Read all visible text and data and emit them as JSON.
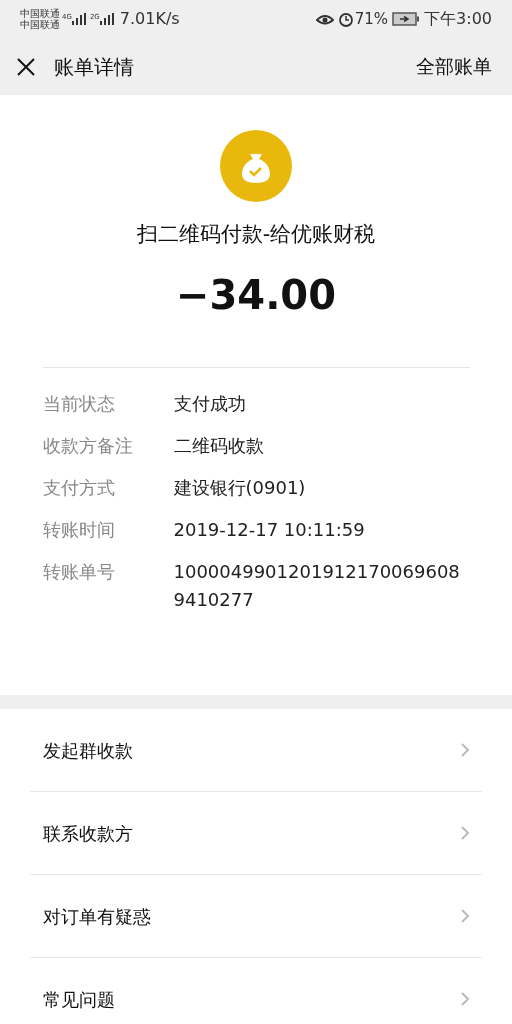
{
  "status_bar": {
    "carriers": [
      "中国联通",
      "中国联通"
    ],
    "networks": [
      "4G",
      "2G"
    ],
    "speed": "7.01K/s",
    "battery": "71%",
    "time": "下午3:00"
  },
  "header": {
    "title": "账单详情",
    "action": "全部账单"
  },
  "summary": {
    "title": "扫二维码付款-给优账财税",
    "amount": "−34.00"
  },
  "details": [
    {
      "label": "当前状态",
      "value": "支付成功"
    },
    {
      "label": "收款方备注",
      "value": "二维码收款"
    },
    {
      "label": "支付方式",
      "value": "建设银行(0901)"
    },
    {
      "label": "转账时间",
      "value": "2019-12-17 10:11:59"
    },
    {
      "label": "转账单号",
      "value": "10000499012019121700696089410277"
    }
  ],
  "menu": [
    {
      "label": "发起群收款"
    },
    {
      "label": "联系收款方"
    },
    {
      "label": "对订单有疑惑"
    },
    {
      "label": "常见问题"
    }
  ]
}
